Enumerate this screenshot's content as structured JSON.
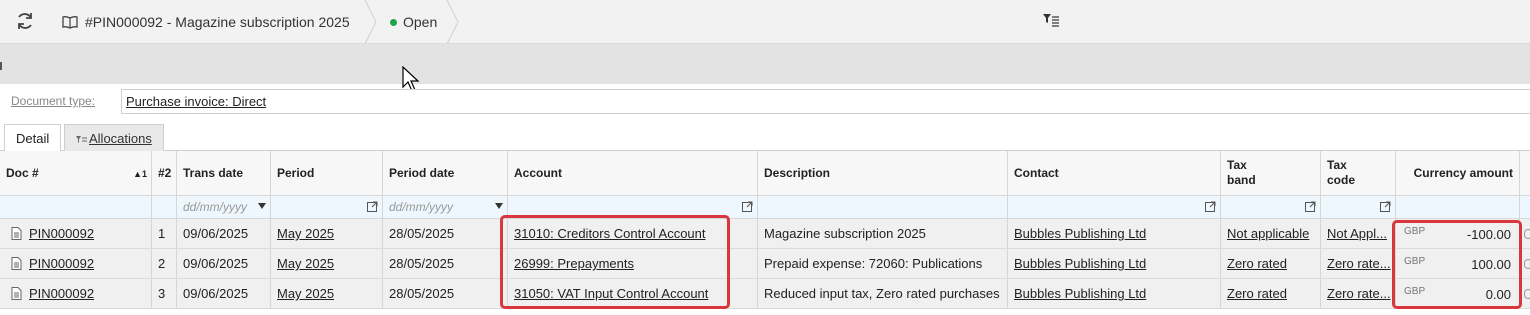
{
  "toolbar": {
    "refresh_icon": "refresh-icon",
    "document_title": "#PIN000092 - Magazine subscription 2025",
    "status": "Open",
    "status_color": "#1ea54a",
    "filter_icon": "filter-list-icon"
  },
  "document_type": {
    "label": "Document type:",
    "value": "Purchase invoice: Direct"
  },
  "tabs": [
    {
      "label": "Detail",
      "active": true
    },
    {
      "label": "Allocations",
      "active": false
    }
  ],
  "grid": {
    "headers": {
      "doc": "Doc #",
      "doc_sort": "▲1",
      "line": "#2",
      "trans_date": "Trans date",
      "period": "Period",
      "period_date": "Period date",
      "account": "Account",
      "description": "Description",
      "contact": "Contact",
      "tax_band_1": "Tax",
      "tax_band_2": "band",
      "tax_code_1": "Tax",
      "tax_code_2": "code",
      "currency_amount": "Currency amount"
    },
    "filters": {
      "trans_date_placeholder": "dd/mm/yyyy",
      "period_date_placeholder": "dd/mm/yyyy"
    },
    "rows": [
      {
        "doc": "PIN000092",
        "line": "1",
        "trans_date": "09/06/2025",
        "period": "May 2025",
        "period_date": "28/05/2025",
        "account": "31010: Creditors Control Account",
        "description": "Magazine subscription 2025",
        "contact": "Bubbles Publishing Ltd",
        "tax_band": "Not applicable",
        "tax_code": "Not Appl...",
        "currency": "GBP",
        "amount": "-100.00"
      },
      {
        "doc": "PIN000092",
        "line": "2",
        "trans_date": "09/06/2025",
        "period": "May 2025",
        "period_date": "28/05/2025",
        "account": "26999: Prepayments",
        "description": "Prepaid expense: 72060: Publications",
        "contact": "Bubbles Publishing Ltd",
        "tax_band": "Zero rated",
        "tax_code": "Zero rate...",
        "currency": "GBP",
        "amount": "100.00"
      },
      {
        "doc": "PIN000092",
        "line": "3",
        "trans_date": "09/06/2025",
        "period": "May 2025",
        "period_date": "28/05/2025",
        "account": "31050: VAT Input Control Account",
        "description": "Reduced input tax, Zero rated purchases",
        "contact": "Bubbles Publishing Ltd",
        "tax_band": "Zero rated",
        "tax_code": "Zero rate...",
        "currency": "GBP",
        "amount": "0.00"
      }
    ]
  },
  "colors": {
    "highlight": "#d9373d",
    "filter_row": "#eef7fd"
  }
}
